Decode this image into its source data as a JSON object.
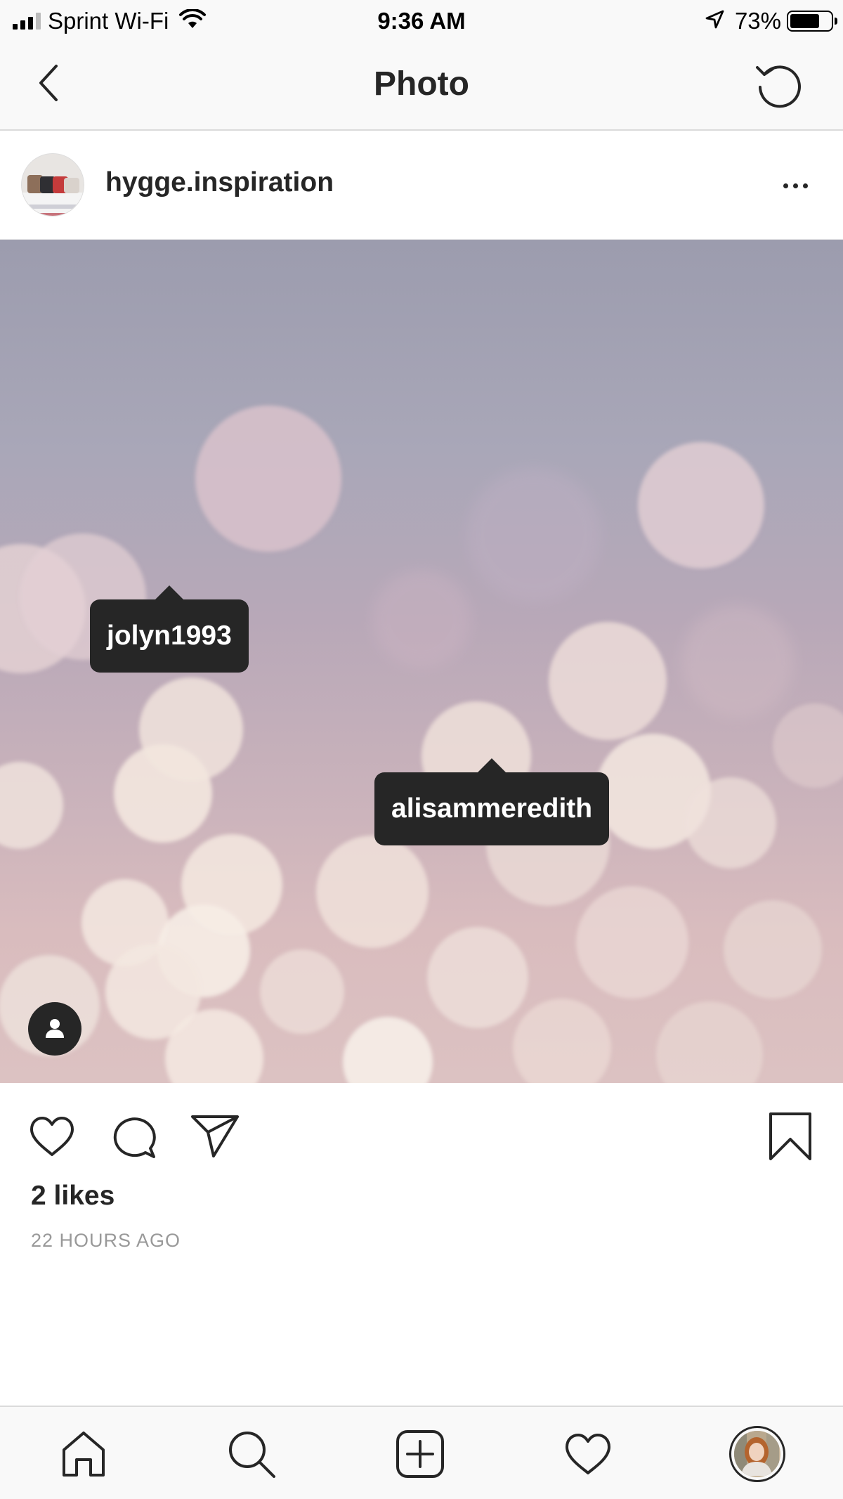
{
  "status_bar": {
    "carrier": "Sprint Wi-Fi",
    "time": "9:36 AM",
    "battery_percent": "73%",
    "battery_level": 0.73,
    "icons": [
      "signal-icon",
      "wifi-icon",
      "location-arrow-icon",
      "battery-icon"
    ]
  },
  "nav": {
    "title": "Photo",
    "back_icon": "chevron-left-icon",
    "refresh_icon": "refresh-icon"
  },
  "post": {
    "username": "hygge.inspiration",
    "more_icon": "more-horizontal-icon",
    "tags": [
      "jolyn1993",
      "alisammeredith"
    ],
    "likes": "2 likes",
    "timestamp": "22 HOURS AGO"
  },
  "actions": {
    "icons": [
      "heart-icon",
      "comment-icon",
      "share-icon",
      "bookmark-icon"
    ]
  },
  "tab_bar": {
    "items": [
      "home-icon",
      "search-icon",
      "new-post-icon",
      "activity-icon",
      "profile-avatar"
    ]
  },
  "colors": {
    "text": "#262626",
    "secondary_text": "#999999",
    "bar_background": "#f9f9f9",
    "divider": "#dbdbdb",
    "tag_background": "#262626"
  }
}
